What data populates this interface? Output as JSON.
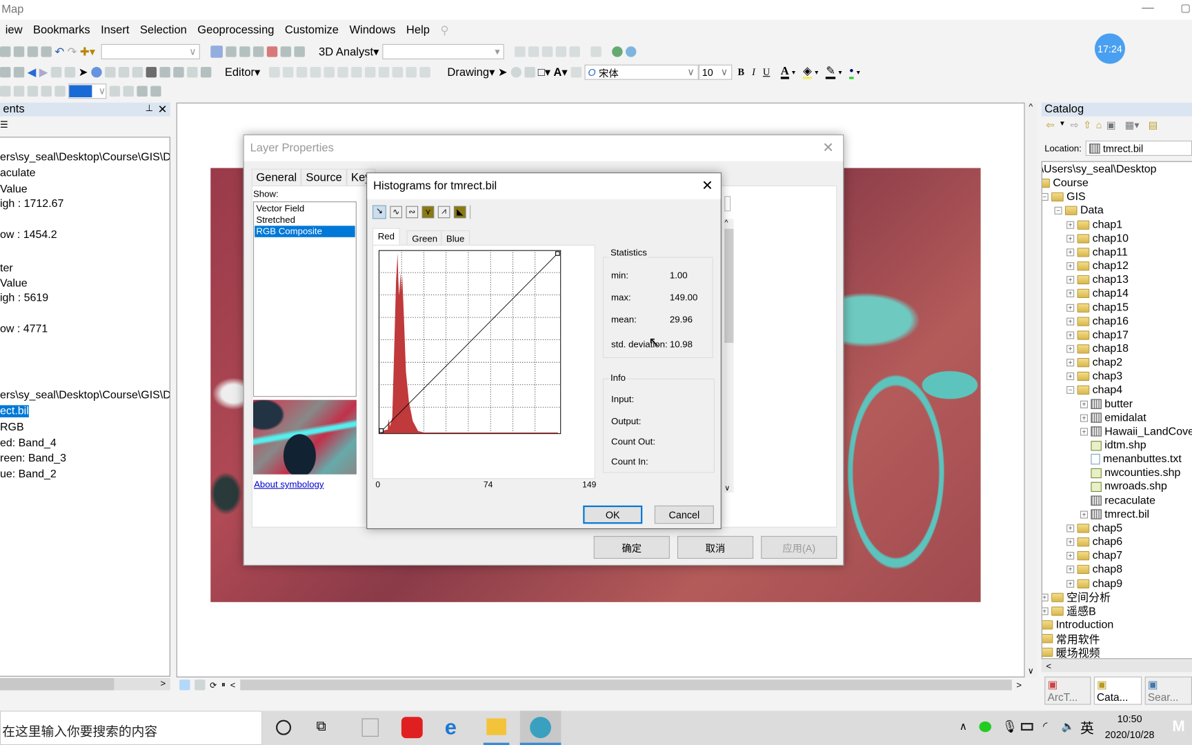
{
  "app": {
    "title": "Map"
  },
  "menu": [
    "iew",
    "Bookmarks",
    "Insert",
    "Selection",
    "Geoprocessing",
    "Customize",
    "Windows",
    "Help"
  ],
  "toolbar": {
    "analyst_label": "3D Analyst",
    "editor_label": "Editor",
    "drawing_label": "Drawing",
    "font_name": "宋体",
    "font_size": "10",
    "bold": "B",
    "italic": "I",
    "underline": "U",
    "text_color": "A",
    "scale_value": "",
    "clock_badge": "17:24"
  },
  "toc": {
    "header": "ents",
    "lines": [
      {
        "text": "ers\\sy_seal\\Desktop\\Course\\GIS\\Da"
      },
      {
        "text": "aculate"
      },
      {
        "text": "Value"
      },
      {
        "text": "igh : 1712.67"
      },
      {
        "text": "ow : 1454.2"
      },
      {
        "text": "ter"
      },
      {
        "text": "Value"
      },
      {
        "text": "igh : 5619"
      },
      {
        "text": "ow : 4771"
      },
      {
        "text": "ers\\sy_seal\\Desktop\\Course\\GIS\\Da"
      },
      {
        "text": "ect.bil"
      },
      {
        "text": "RGB"
      },
      {
        "text": "ed:   Band_4"
      },
      {
        "text": "reen: Band_3"
      },
      {
        "text": "ue:   Band_2"
      }
    ]
  },
  "catalog": {
    "header": "Catalog",
    "location_label": "Location:",
    "location_value": "tmrect.bil",
    "tree": [
      {
        "label": ":\\Users\\sy_seal\\Desktop",
        "icon": "none",
        "pm": ""
      },
      {
        "label": "Course",
        "icon": "folder",
        "pm": ""
      },
      {
        "label": "GIS",
        "icon": "folder",
        "pm": "-"
      },
      {
        "label": "Data",
        "icon": "folder",
        "pm": "-"
      },
      {
        "label": "chap1",
        "icon": "folder",
        "pm": "+"
      },
      {
        "label": "chap10",
        "icon": "folder",
        "pm": "+"
      },
      {
        "label": "chap11",
        "icon": "folder",
        "pm": "+"
      },
      {
        "label": "chap12",
        "icon": "folder",
        "pm": "+"
      },
      {
        "label": "chap13",
        "icon": "folder",
        "pm": "+"
      },
      {
        "label": "chap14",
        "icon": "folder",
        "pm": "+"
      },
      {
        "label": "chap15",
        "icon": "folder",
        "pm": "+"
      },
      {
        "label": "chap16",
        "icon": "folder",
        "pm": "+"
      },
      {
        "label": "chap17",
        "icon": "folder",
        "pm": "+"
      },
      {
        "label": "chap18",
        "icon": "folder",
        "pm": "+"
      },
      {
        "label": "chap2",
        "icon": "folder",
        "pm": "+"
      },
      {
        "label": "chap3",
        "icon": "folder",
        "pm": "+"
      },
      {
        "label": "chap4",
        "icon": "folder",
        "pm": "-"
      },
      {
        "label": "butter",
        "icon": "raster",
        "pm": "+"
      },
      {
        "label": "emidalat",
        "icon": "raster",
        "pm": "+"
      },
      {
        "label": "Hawaii_LandCove",
        "icon": "raster",
        "pm": "+"
      },
      {
        "label": "idtm.shp",
        "icon": "shp",
        "pm": ""
      },
      {
        "label": "menanbuttes.txt",
        "icon": "txt",
        "pm": ""
      },
      {
        "label": "nwcounties.shp",
        "icon": "shp",
        "pm": ""
      },
      {
        "label": "nwroads.shp",
        "icon": "shp",
        "pm": ""
      },
      {
        "label": "recaculate",
        "icon": "raster",
        "pm": ""
      },
      {
        "label": "tmrect.bil",
        "icon": "raster",
        "pm": "+"
      },
      {
        "label": "chap5",
        "icon": "folder",
        "pm": "+"
      },
      {
        "label": "chap6",
        "icon": "folder",
        "pm": "+"
      },
      {
        "label": "chap7",
        "icon": "folder",
        "pm": "+"
      },
      {
        "label": "chap8",
        "icon": "folder",
        "pm": "+"
      },
      {
        "label": "chap9",
        "icon": "folder",
        "pm": "+"
      },
      {
        "label": "空间分析",
        "icon": "folder",
        "pm": "+"
      },
      {
        "label": "遥感B",
        "icon": "folder",
        "pm": "+"
      },
      {
        "label": "Introduction",
        "icon": "folder",
        "pm": ""
      },
      {
        "label": "常用软件",
        "icon": "folder",
        "pm": ""
      },
      {
        "label": "暖场视频",
        "icon": "folder",
        "pm": ""
      }
    ],
    "tabs": [
      "ArcT...",
      "Cata...",
      "Sear..."
    ]
  },
  "layer_props": {
    "title": "Layer Properties",
    "tabs": [
      "General",
      "Source",
      "Key"
    ],
    "show_label": "Show:",
    "show_items": [
      "Vector Field",
      "Stretched",
      "RGB Composite"
    ],
    "selected_show": "RGB Composite",
    "about_link": "About symbology",
    "ok": "确定",
    "cancel": "取消",
    "apply": "应用(A)"
  },
  "histogram": {
    "title": "Histograms for tmrect.bil",
    "band_tabs": [
      "Red",
      "Green",
      "Blue"
    ],
    "active_band": "Red",
    "x_ticks": [
      "0",
      "74",
      "149"
    ],
    "statistics_label": "Statistics",
    "stats": [
      {
        "label": "min:",
        "value": "1.00"
      },
      {
        "label": "max:",
        "value": "149.00"
      },
      {
        "label": "mean:",
        "value": "29.96"
      },
      {
        "label": "std. deviation:",
        "value": "10.98"
      }
    ],
    "info_label": "Info",
    "info": [
      "Input:",
      "Output:",
      "Count Out:",
      "Count In:"
    ],
    "ok": "OK",
    "cancel": "Cancel",
    "hist_color": "#c0393b"
  },
  "taskbar": {
    "search_placeholder": "在这里输入你要搜索的内容",
    "time": "10:50",
    "date": "2020/10/28",
    "ime": "英"
  }
}
